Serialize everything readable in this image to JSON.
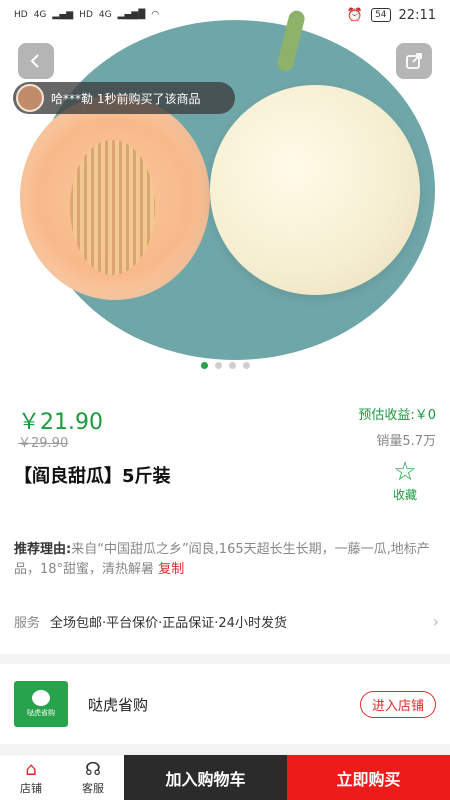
{
  "status_bar": {
    "left": [
      "HD",
      "4G",
      "HD",
      "4G"
    ],
    "battery": "54",
    "time": "22:11"
  },
  "hero": {
    "buyer_notice": "哈***勒 1秒前购买了该商品",
    "dots_active": 0,
    "dots_count": 4
  },
  "product": {
    "price": "￥21.90",
    "original_price": "￥29.90",
    "estimated_earnings": "预估收益:￥0",
    "sales": "销量5.7万",
    "title": "【阎良甜瓜】5斤装",
    "favorite_label": "收藏",
    "reason_label": "推荐理由:",
    "reason_text": "来自“中国甜瓜之乡”阎良,165天超长生长期，一藤一瓜,地标产品，18°甜蜜，清热解暑",
    "copy_label": "复制"
  },
  "service": {
    "label": "服务",
    "items": "全场包邮·平台保价·正品保证·24小时发货"
  },
  "shop": {
    "logo_text": "哒虎省购",
    "name": "哒虎省购",
    "enter_label": "进入店铺"
  },
  "bottom_bar": {
    "shop_label": "店铺",
    "service_label": "客服",
    "add_to_cart": "加入购物车",
    "buy_now": "立即购买"
  },
  "colors": {
    "accent_green": "#1a9b3d",
    "accent_red": "#ee1b1b"
  }
}
